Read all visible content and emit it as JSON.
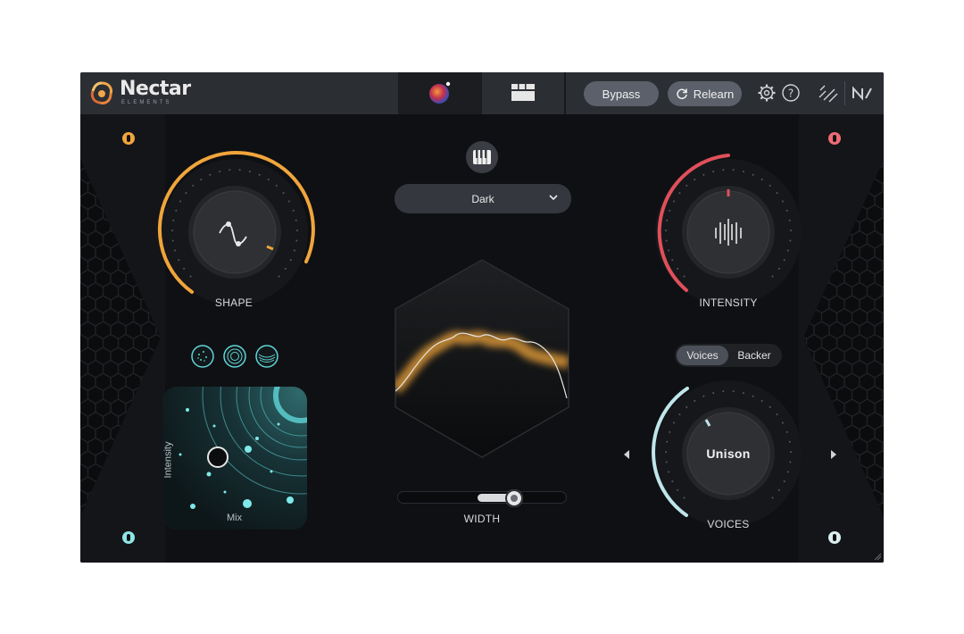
{
  "app": {
    "brand": "Nectar",
    "brand_sub": "ELEMENTS"
  },
  "topbar": {
    "bypass_label": "Bypass",
    "relearn_label": "Relearn"
  },
  "style_dropdown": {
    "value": "Dark"
  },
  "controls": {
    "shape": {
      "label": "SHAPE",
      "level": 0.72
    },
    "intensity": {
      "label": "INTENSITY",
      "level": 0.5
    },
    "voices": {
      "label": "VOICES",
      "value": "Unison",
      "level": 0.15
    },
    "width": {
      "label": "WIDTH",
      "level": 0.7
    }
  },
  "voice_mode": {
    "options": [
      "Voices",
      "Backer"
    ],
    "selected": "Voices"
  },
  "xy_pad": {
    "x_label": "Mix",
    "y_label": "Intensity"
  },
  "colors": {
    "shape_accent": "#f0a53b",
    "intensity_accent": "#e0505a",
    "voices_accent": "#bfe6ea",
    "teal": "#5fd6d8"
  },
  "icons": {
    "logo": "nectar-flower-logo",
    "main_tab": "assistant-orb-icon",
    "modules_tab": "modules-grid-icon",
    "relearn": "refresh-icon",
    "settings": "gear-icon",
    "help": "help-icon",
    "link": "link-icon",
    "ni": "ni-logo-icon",
    "keys": "piano-keys-icon"
  }
}
